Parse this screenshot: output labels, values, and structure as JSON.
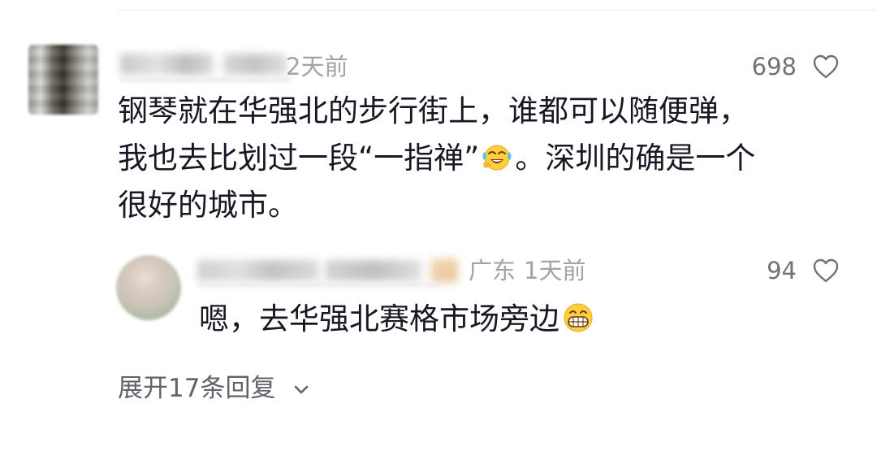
{
  "main_comment": {
    "time": "2天前",
    "like_count": "698",
    "text_lines": [
      "钢琴就在华强北的步行街上，谁都可以随便弹，",
      "我也去比划过一段“一指禅”",
      "。深圳的确是一个",
      "很好的城市。"
    ],
    "emoji": "laugh-cry-emoji"
  },
  "reply": {
    "location": "广东",
    "time": "1天前",
    "like_count": "94",
    "text": "嗯，去华强北赛格市场旁边",
    "emoji": "grin-emoji"
  },
  "expand_replies": {
    "label": "展开17条回复"
  },
  "colors": {
    "text_primary": "#161823",
    "text_secondary": "#a0a3a8",
    "like_count": "#6f7278",
    "expand": "#5f6268"
  }
}
